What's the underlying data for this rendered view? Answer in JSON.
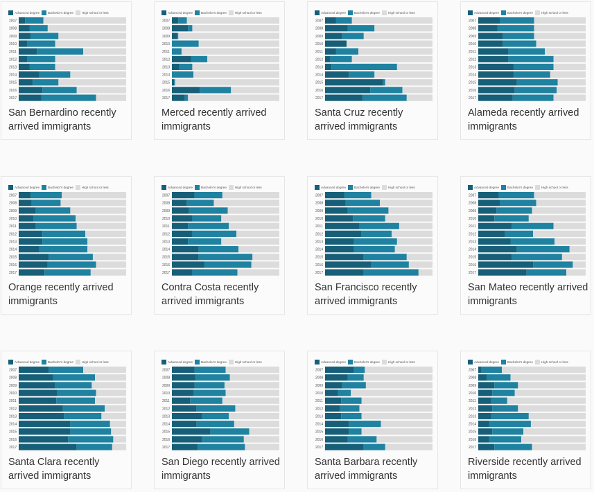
{
  "legend": {
    "advanced": "Advanced degree",
    "bachelors": "Bachelor's degree",
    "highschool": "High school or less"
  },
  "colors": {
    "advanced": "#175f78",
    "bachelors": "#1f82a0",
    "highschool": "#dcdcdc"
  },
  "chart_data": [
    {
      "type": "bar",
      "stacked": true,
      "orientation": "horizontal",
      "title": "San Bernardino recently arrived immigrants",
      "categories": [
        "2007",
        "2008",
        "2009",
        "2010",
        "2011",
        "2012",
        "2013",
        "2014",
        "2015",
        "2016",
        "2017"
      ],
      "series": [
        {
          "name": "Advanced degree",
          "values": [
            6,
            10,
            11,
            8,
            17,
            8,
            10,
            19,
            13,
            22,
            21
          ]
        },
        {
          "name": "Bachelor's degree",
          "values": [
            17,
            17,
            26,
            26,
            43,
            26,
            24,
            29,
            24,
            32,
            51
          ]
        },
        {
          "name": "High school or less",
          "values": [
            77,
            73,
            63,
            66,
            40,
            66,
            66,
            52,
            63,
            46,
            28
          ]
        }
      ],
      "xlim": [
        0,
        100
      ]
    },
    {
      "type": "bar",
      "stacked": true,
      "orientation": "horizontal",
      "title": "Merced recently arrived immigrants",
      "categories": [
        "2007",
        "2008",
        "2009",
        "2010",
        "2011",
        "2012",
        "2013",
        "2014",
        "2015",
        "2016",
        "2017"
      ],
      "series": [
        {
          "name": "Advanced degree",
          "values": [
            6,
            15,
            5,
            0,
            0,
            18,
            7,
            0,
            2,
            26,
            12
          ]
        },
        {
          "name": "Bachelor's degree",
          "values": [
            8,
            4,
            1,
            25,
            9,
            15,
            12,
            20,
            1,
            29,
            3
          ]
        },
        {
          "name": "High school or less",
          "values": [
            86,
            81,
            94,
            75,
            91,
            67,
            81,
            80,
            97,
            45,
            85
          ]
        }
      ],
      "xlim": [
        0,
        100
      ]
    },
    {
      "type": "bar",
      "stacked": true,
      "orientation": "horizontal",
      "title": "Santa Cruz recently arrived immigrants",
      "categories": [
        "2007",
        "2008",
        "2009",
        "2010",
        "2011",
        "2012",
        "2013",
        "2014",
        "2015",
        "2016",
        "2017"
      ],
      "series": [
        {
          "name": "Advanced degree",
          "values": [
            10,
            21,
            16,
            20,
            10,
            5,
            6,
            22,
            54,
            42,
            35
          ]
        },
        {
          "name": "Bachelor's degree",
          "values": [
            15,
            25,
            20,
            0,
            21,
            20,
            61,
            24,
            2,
            30,
            41
          ]
        },
        {
          "name": "High school or less",
          "values": [
            75,
            54,
            64,
            80,
            69,
            75,
            33,
            54,
            44,
            28,
            24
          ]
        }
      ],
      "xlim": [
        0,
        100
      ]
    },
    {
      "type": "bar",
      "stacked": true,
      "orientation": "horizontal",
      "title": "Alameda recently arrived immigrants",
      "categories": [
        "2007",
        "2008",
        "2009",
        "2010",
        "2011",
        "2012",
        "2013",
        "2014",
        "2015",
        "2016",
        "2017"
      ],
      "series": [
        {
          "name": "Advanced degree",
          "values": [
            20,
            18,
            23,
            23,
            28,
            28,
            33,
            33,
            36,
            34,
            32
          ]
        },
        {
          "name": "Bachelor's degree",
          "values": [
            32,
            34,
            29,
            31,
            34,
            42,
            37,
            34,
            38,
            39,
            38
          ]
        },
        {
          "name": "High school or less",
          "values": [
            48,
            48,
            48,
            46,
            38,
            30,
            30,
            33,
            26,
            27,
            30
          ]
        }
      ],
      "xlim": [
        0,
        100
      ]
    },
    {
      "type": "bar",
      "stacked": true,
      "orientation": "horizontal",
      "title": "Orange recently arrived immigrants",
      "categories": [
        "2007",
        "2008",
        "2009",
        "2010",
        "2011",
        "2012",
        "2013",
        "2014",
        "2015",
        "2016",
        "2017"
      ],
      "series": [
        {
          "name": "Advanced degree",
          "values": [
            11,
            12,
            16,
            14,
            16,
            22,
            22,
            19,
            28,
            27,
            24
          ]
        },
        {
          "name": "Bachelor's degree",
          "values": [
            29,
            27,
            32,
            39,
            38,
            40,
            42,
            45,
            41,
            45,
            43
          ]
        },
        {
          "name": "High school or less",
          "values": [
            60,
            61,
            52,
            47,
            46,
            38,
            36,
            36,
            31,
            28,
            33
          ]
        }
      ],
      "xlim": [
        0,
        100
      ]
    },
    {
      "type": "bar",
      "stacked": true,
      "orientation": "horizontal",
      "title": "Contra Costa recently arrived immigrants",
      "categories": [
        "2007",
        "2008",
        "2009",
        "2010",
        "2011",
        "2012",
        "2013",
        "2014",
        "2015",
        "2016",
        "2017"
      ],
      "series": [
        {
          "name": "Advanced degree",
          "values": [
            21,
            14,
            16,
            19,
            15,
            19,
            15,
            25,
            25,
            30,
            19
          ]
        },
        {
          "name": "Bachelor's degree",
          "values": [
            26,
            25,
            36,
            27,
            38,
            41,
            31,
            37,
            50,
            44,
            42
          ]
        },
        {
          "name": "High school or less",
          "values": [
            53,
            61,
            48,
            54,
            47,
            40,
            54,
            38,
            25,
            26,
            39
          ]
        }
      ],
      "xlim": [
        0,
        100
      ]
    },
    {
      "type": "bar",
      "stacked": true,
      "orientation": "horizontal",
      "title": "San Francisco recently arrived immigrants",
      "categories": [
        "2007",
        "2008",
        "2009",
        "2010",
        "2011",
        "2012",
        "2013",
        "2014",
        "2015",
        "2016",
        "2017"
      ],
      "series": [
        {
          "name": "Advanced degree",
          "values": [
            18,
            19,
            21,
            26,
            32,
            34,
            27,
            27,
            36,
            43,
            36
          ]
        },
        {
          "name": "Bachelor's degree",
          "values": [
            25,
            32,
            38,
            30,
            37,
            28,
            40,
            38,
            40,
            35,
            51
          ]
        },
        {
          "name": "High school or less",
          "values": [
            57,
            49,
            41,
            44,
            31,
            38,
            33,
            35,
            24,
            22,
            13
          ]
        }
      ],
      "xlim": [
        0,
        100
      ]
    },
    {
      "type": "bar",
      "stacked": true,
      "orientation": "horizontal",
      "title": "San Mateo recently arrived immigrants",
      "categories": [
        "2007",
        "2008",
        "2009",
        "2010",
        "2011",
        "2012",
        "2013",
        "2014",
        "2015",
        "2016",
        "2017"
      ],
      "series": [
        {
          "name": "Advanced degree",
          "values": [
            19,
            20,
            17,
            15,
            31,
            25,
            30,
            36,
            31,
            51,
            45
          ]
        },
        {
          "name": "Bachelor's degree",
          "values": [
            33,
            34,
            33,
            32,
            39,
            26,
            41,
            49,
            47,
            37,
            37
          ]
        },
        {
          "name": "High school or less",
          "values": [
            48,
            46,
            50,
            53,
            30,
            49,
            29,
            15,
            22,
            12,
            18
          ]
        }
      ],
      "xlim": [
        0,
        100
      ]
    },
    {
      "type": "bar",
      "stacked": true,
      "orientation": "horizontal",
      "title": "Santa Clara recently arrived immigrants",
      "categories": [
        "2007",
        "2008",
        "2009",
        "2010",
        "2011",
        "2012",
        "2013",
        "2014",
        "2015",
        "2016",
        "2017"
      ],
      "series": [
        {
          "name": "Advanced degree",
          "values": [
            28,
            32,
            34,
            36,
            35,
            41,
            42,
            48,
            48,
            46,
            54
          ]
        },
        {
          "name": "Bachelor's degree",
          "values": [
            32,
            39,
            34,
            36,
            36,
            39,
            35,
            37,
            38,
            42,
            33
          ]
        },
        {
          "name": "High school or less",
          "values": [
            40,
            29,
            32,
            28,
            29,
            20,
            23,
            15,
            14,
            12,
            13
          ]
        }
      ],
      "xlim": [
        0,
        100
      ]
    },
    {
      "type": "bar",
      "stacked": true,
      "orientation": "horizontal",
      "title": "San Diego recently arrived immigrants",
      "categories": [
        "2007",
        "2008",
        "2009",
        "2010",
        "2011",
        "2012",
        "2013",
        "2014",
        "2015",
        "2016",
        "2017"
      ],
      "series": [
        {
          "name": "Advanced degree",
          "values": [
            21,
            22,
            21,
            20,
            17,
            23,
            28,
            23,
            36,
            28,
            24
          ]
        },
        {
          "name": "Bachelor's degree",
          "values": [
            29,
            32,
            28,
            30,
            30,
            36,
            25,
            35,
            36,
            39,
            44
          ]
        },
        {
          "name": "High school or less",
          "values": [
            50,
            46,
            51,
            50,
            53,
            41,
            47,
            42,
            28,
            33,
            32
          ]
        }
      ],
      "xlim": [
        0,
        100
      ]
    },
    {
      "type": "bar",
      "stacked": true,
      "orientation": "horizontal",
      "title": "Santa Barbara recently arrived immigrants",
      "categories": [
        "2007",
        "2008",
        "2009",
        "2010",
        "2011",
        "2012",
        "2013",
        "2014",
        "2015",
        "2016",
        "2017"
      ],
      "series": [
        {
          "name": "Advanced degree",
          "values": [
            27,
            21,
            16,
            12,
            15,
            14,
            15,
            22,
            22,
            21,
            36
          ]
        },
        {
          "name": "Bachelor's degree",
          "values": [
            10,
            15,
            22,
            12,
            19,
            18,
            19,
            30,
            12,
            27,
            20
          ]
        },
        {
          "name": "High school or less",
          "values": [
            63,
            64,
            62,
            76,
            66,
            68,
            66,
            48,
            66,
            52,
            44
          ]
        }
      ],
      "xlim": [
        0,
        100
      ]
    },
    {
      "type": "bar",
      "stacked": true,
      "orientation": "horizontal",
      "title": "Riverside recently arrived immigrants",
      "categories": [
        "2007",
        "2008",
        "2009",
        "2010",
        "2011",
        "2012",
        "2013",
        "2014",
        "2015",
        "2016",
        "2017"
      ],
      "series": [
        {
          "name": "Advanced degree",
          "values": [
            3,
            8,
            15,
            13,
            12,
            13,
            12,
            10,
            13,
            10,
            15
          ]
        },
        {
          "name": "Bachelor's degree",
          "values": [
            19,
            22,
            22,
            21,
            15,
            24,
            35,
            39,
            29,
            30,
            35
          ]
        },
        {
          "name": "High school or less",
          "values": [
            78,
            70,
            63,
            66,
            73,
            63,
            53,
            51,
            58,
            60,
            50
          ]
        }
      ],
      "xlim": [
        0,
        100
      ]
    }
  ]
}
